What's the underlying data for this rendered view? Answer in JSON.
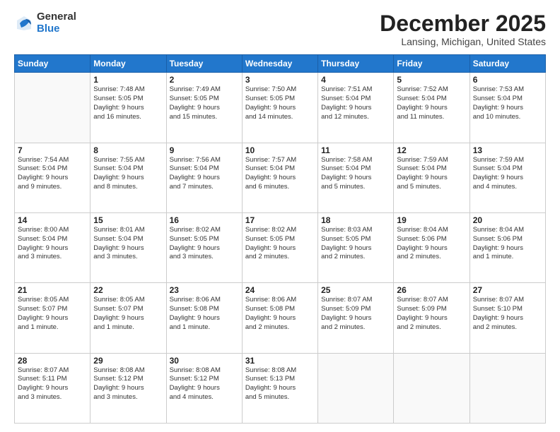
{
  "logo": {
    "general": "General",
    "blue": "Blue"
  },
  "header": {
    "month": "December 2025",
    "location": "Lansing, Michigan, United States"
  },
  "weekdays": [
    "Sunday",
    "Monday",
    "Tuesday",
    "Wednesday",
    "Thursday",
    "Friday",
    "Saturday"
  ],
  "weeks": [
    [
      {
        "day": "",
        "info": ""
      },
      {
        "day": "1",
        "info": "Sunrise: 7:48 AM\nSunset: 5:05 PM\nDaylight: 9 hours\nand 16 minutes."
      },
      {
        "day": "2",
        "info": "Sunrise: 7:49 AM\nSunset: 5:05 PM\nDaylight: 9 hours\nand 15 minutes."
      },
      {
        "day": "3",
        "info": "Sunrise: 7:50 AM\nSunset: 5:05 PM\nDaylight: 9 hours\nand 14 minutes."
      },
      {
        "day": "4",
        "info": "Sunrise: 7:51 AM\nSunset: 5:04 PM\nDaylight: 9 hours\nand 12 minutes."
      },
      {
        "day": "5",
        "info": "Sunrise: 7:52 AM\nSunset: 5:04 PM\nDaylight: 9 hours\nand 11 minutes."
      },
      {
        "day": "6",
        "info": "Sunrise: 7:53 AM\nSunset: 5:04 PM\nDaylight: 9 hours\nand 10 minutes."
      }
    ],
    [
      {
        "day": "7",
        "info": "Sunrise: 7:54 AM\nSunset: 5:04 PM\nDaylight: 9 hours\nand 9 minutes."
      },
      {
        "day": "8",
        "info": "Sunrise: 7:55 AM\nSunset: 5:04 PM\nDaylight: 9 hours\nand 8 minutes."
      },
      {
        "day": "9",
        "info": "Sunrise: 7:56 AM\nSunset: 5:04 PM\nDaylight: 9 hours\nand 7 minutes."
      },
      {
        "day": "10",
        "info": "Sunrise: 7:57 AM\nSunset: 5:04 PM\nDaylight: 9 hours\nand 6 minutes."
      },
      {
        "day": "11",
        "info": "Sunrise: 7:58 AM\nSunset: 5:04 PM\nDaylight: 9 hours\nand 5 minutes."
      },
      {
        "day": "12",
        "info": "Sunrise: 7:59 AM\nSunset: 5:04 PM\nDaylight: 9 hours\nand 5 minutes."
      },
      {
        "day": "13",
        "info": "Sunrise: 7:59 AM\nSunset: 5:04 PM\nDaylight: 9 hours\nand 4 minutes."
      }
    ],
    [
      {
        "day": "14",
        "info": "Sunrise: 8:00 AM\nSunset: 5:04 PM\nDaylight: 9 hours\nand 3 minutes."
      },
      {
        "day": "15",
        "info": "Sunrise: 8:01 AM\nSunset: 5:04 PM\nDaylight: 9 hours\nand 3 minutes."
      },
      {
        "day": "16",
        "info": "Sunrise: 8:02 AM\nSunset: 5:05 PM\nDaylight: 9 hours\nand 3 minutes."
      },
      {
        "day": "17",
        "info": "Sunrise: 8:02 AM\nSunset: 5:05 PM\nDaylight: 9 hours\nand 2 minutes."
      },
      {
        "day": "18",
        "info": "Sunrise: 8:03 AM\nSunset: 5:05 PM\nDaylight: 9 hours\nand 2 minutes."
      },
      {
        "day": "19",
        "info": "Sunrise: 8:04 AM\nSunset: 5:06 PM\nDaylight: 9 hours\nand 2 minutes."
      },
      {
        "day": "20",
        "info": "Sunrise: 8:04 AM\nSunset: 5:06 PM\nDaylight: 9 hours\nand 1 minute."
      }
    ],
    [
      {
        "day": "21",
        "info": "Sunrise: 8:05 AM\nSunset: 5:07 PM\nDaylight: 9 hours\nand 1 minute."
      },
      {
        "day": "22",
        "info": "Sunrise: 8:05 AM\nSunset: 5:07 PM\nDaylight: 9 hours\nand 1 minute."
      },
      {
        "day": "23",
        "info": "Sunrise: 8:06 AM\nSunset: 5:08 PM\nDaylight: 9 hours\nand 1 minute."
      },
      {
        "day": "24",
        "info": "Sunrise: 8:06 AM\nSunset: 5:08 PM\nDaylight: 9 hours\nand 2 minutes."
      },
      {
        "day": "25",
        "info": "Sunrise: 8:07 AM\nSunset: 5:09 PM\nDaylight: 9 hours\nand 2 minutes."
      },
      {
        "day": "26",
        "info": "Sunrise: 8:07 AM\nSunset: 5:09 PM\nDaylight: 9 hours\nand 2 minutes."
      },
      {
        "day": "27",
        "info": "Sunrise: 8:07 AM\nSunset: 5:10 PM\nDaylight: 9 hours\nand 2 minutes."
      }
    ],
    [
      {
        "day": "28",
        "info": "Sunrise: 8:07 AM\nSunset: 5:11 PM\nDaylight: 9 hours\nand 3 minutes."
      },
      {
        "day": "29",
        "info": "Sunrise: 8:08 AM\nSunset: 5:12 PM\nDaylight: 9 hours\nand 3 minutes."
      },
      {
        "day": "30",
        "info": "Sunrise: 8:08 AM\nSunset: 5:12 PM\nDaylight: 9 hours\nand 4 minutes."
      },
      {
        "day": "31",
        "info": "Sunrise: 8:08 AM\nSunset: 5:13 PM\nDaylight: 9 hours\nand 5 minutes."
      },
      {
        "day": "",
        "info": ""
      },
      {
        "day": "",
        "info": ""
      },
      {
        "day": "",
        "info": ""
      }
    ]
  ]
}
